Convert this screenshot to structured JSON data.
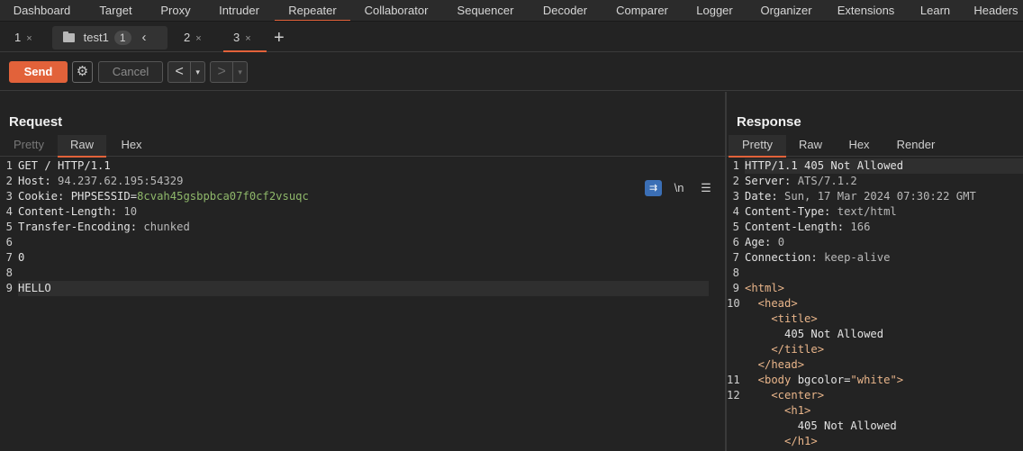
{
  "tool_tabs": [
    {
      "label": "Dashboard",
      "active": false
    },
    {
      "label": "Target",
      "active": false
    },
    {
      "label": "Proxy",
      "active": false
    },
    {
      "label": "Intruder",
      "active": false
    },
    {
      "label": "Repeater",
      "active": true
    },
    {
      "label": "Collaborator",
      "active": false
    },
    {
      "label": "Sequencer",
      "active": false
    },
    {
      "label": "Decoder",
      "active": false
    },
    {
      "label": "Comparer",
      "active": false
    },
    {
      "label": "Logger",
      "active": false
    },
    {
      "label": "Organizer",
      "active": false
    },
    {
      "label": "Extensions",
      "active": false
    },
    {
      "label": "Learn",
      "active": false
    },
    {
      "label": "Headers",
      "active": false
    }
  ],
  "repeater_tabs": {
    "tab1": {
      "label": "1",
      "close": "×"
    },
    "group": {
      "label": "test1",
      "count": "1",
      "collapse": "‹"
    },
    "tab2": {
      "label": "2",
      "close": "×"
    },
    "tab3": {
      "label": "3",
      "close": "×"
    },
    "add": "+"
  },
  "actions": {
    "send_label": "Send",
    "gear": "⚙",
    "cancel_label": "Cancel",
    "back": "<",
    "forward": ">",
    "dropdown": "▾"
  },
  "request": {
    "title": "Request",
    "tabs": [
      "Pretty",
      "Raw",
      "Hex"
    ],
    "active_tab": "Raw",
    "wrap_icon": "⇉",
    "newline_toggle": "\\n",
    "menu_icon": "☰",
    "lines": [
      {
        "n": "1",
        "k": "GET / HTTP/1.1",
        "v": ""
      },
      {
        "n": "2",
        "k": "Host: ",
        "v": "94.237.62.195:54329"
      },
      {
        "n": "3",
        "k": "Cookie: PHPSESSID=",
        "v": "8cvah45gsbpbca07f0cf2vsuqc"
      },
      {
        "n": "4",
        "k": "Content-Length: ",
        "v": "10"
      },
      {
        "n": "5",
        "k": "Transfer-Encoding: ",
        "v": "chunked"
      },
      {
        "n": "6",
        "k": "",
        "v": ""
      },
      {
        "n": "7",
        "k": "0",
        "v": ""
      },
      {
        "n": "8",
        "k": "",
        "v": ""
      },
      {
        "n": "9",
        "k": "HELLO",
        "v": ""
      }
    ]
  },
  "response": {
    "title": "Response",
    "tabs": [
      "Pretty",
      "Raw",
      "Hex",
      "Render"
    ],
    "active_tab": "Pretty",
    "lines": [
      {
        "n": "1",
        "k": "HTTP/1.1 405 Not Allowed",
        "v": ""
      },
      {
        "n": "2",
        "k": "Server: ",
        "v": "ATS/7.1.2"
      },
      {
        "n": "3",
        "k": "Date: ",
        "v": "Sun, 17 Mar 2024 07:30:22 GMT"
      },
      {
        "n": "4",
        "k": "Content-Type: ",
        "v": "text/html"
      },
      {
        "n": "5",
        "k": "Content-Length: ",
        "v": "166"
      },
      {
        "n": "6",
        "k": "Age: ",
        "v": "0"
      },
      {
        "n": "7",
        "k": "Connection: ",
        "v": "keep-alive"
      },
      {
        "n": "8",
        "k": "",
        "v": ""
      },
      {
        "n": "9",
        "k": "<html>",
        "v": ""
      },
      {
        "n": "10",
        "k": "  <head>",
        "v": ""
      },
      {
        "n": "",
        "k": "    <title>",
        "v": ""
      },
      {
        "n": "",
        "k": "      405 Not Allowed",
        "v": ""
      },
      {
        "n": "",
        "k": "    </title>",
        "v": ""
      },
      {
        "n": "",
        "k": "  </head>",
        "v": ""
      },
      {
        "n": "11",
        "k": "  <body bgcolor=\"white\">",
        "v": ""
      },
      {
        "n": "12",
        "k": "    <center>",
        "v": ""
      },
      {
        "n": "",
        "k": "      <h1>",
        "v": ""
      },
      {
        "n": "",
        "k": "        405 Not Allowed",
        "v": ""
      },
      {
        "n": "",
        "k": "      </h1>",
        "v": ""
      }
    ]
  }
}
